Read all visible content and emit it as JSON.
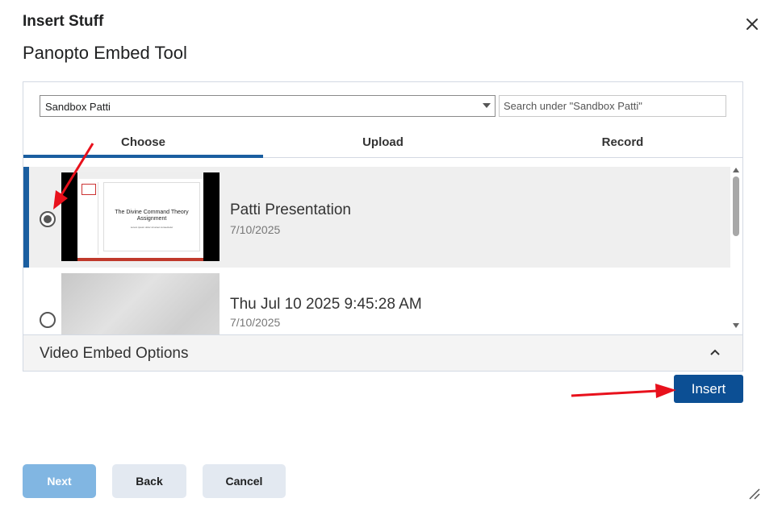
{
  "dialog": {
    "title": "Insert Stuff",
    "tool_title": "Panopto Embed Tool"
  },
  "folder": {
    "selected": "Sandbox Patti"
  },
  "search": {
    "placeholder": "Search under \"Sandbox Patti\""
  },
  "tabs": [
    {
      "label": "Choose",
      "active": true
    },
    {
      "label": "Upload",
      "active": false
    },
    {
      "label": "Record",
      "active": false
    }
  ],
  "sessions": [
    {
      "title": "Patti Presentation",
      "date": "7/10/2025",
      "selected": true,
      "thumb_slide_title": "The Divine Command Theory Assignment",
      "thumb_slide_subtitle": "Lorem ipsum dolor sit amet consectetur"
    },
    {
      "title": "Thu Jul 10 2025 9:45:28 AM",
      "date": "7/10/2025",
      "selected": false
    }
  ],
  "embed_options": {
    "label": "Video Embed Options"
  },
  "buttons": {
    "insert": "Insert",
    "next": "Next",
    "back": "Back",
    "cancel": "Cancel"
  },
  "colors": {
    "primary": "#0c4f94",
    "accent": "#1a5ea0",
    "disabled": "#81b6e2",
    "secondary": "#e3e9f1",
    "annotation_arrow": "#e8111c"
  }
}
